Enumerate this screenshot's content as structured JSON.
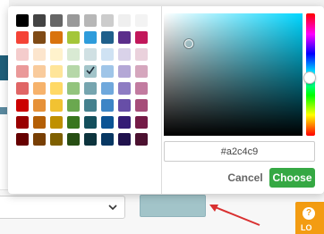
{
  "colors": {
    "accent_green": "#35a843",
    "selected": "#a2c4c9",
    "annotation_red": "#d93030",
    "orange_tab": "#f39c12"
  },
  "palette": {
    "rows": [
      [
        "#000000",
        "#434343",
        "#666666",
        "#999999",
        "#b7b7b7",
        "#cccccc",
        "#efefef",
        "#f3f3f3"
      ],
      [
        "#f44336",
        "#7f4a15",
        "#d9730d",
        "#a4c639",
        "#2e9cdb",
        "#1f5f8b",
        "#5b2e8b",
        "#c2185b"
      ],
      [
        "#f4cccc",
        "#fce5cd",
        "#fff2cc",
        "#d9ead3",
        "#d0e0e3",
        "#cfe2f3",
        "#d9d2e9",
        "#ead1dc"
      ],
      [
        "#ea9999",
        "#f9cb9c",
        "#ffe599",
        "#b6d7a8",
        "#a2c4c9",
        "#9fc5e8",
        "#b4a7d6",
        "#d5a6bd"
      ],
      [
        "#e06666",
        "#f6b26b",
        "#ffd966",
        "#93c47d",
        "#76a5af",
        "#6fa8dc",
        "#8e7cc3",
        "#c27ba0"
      ],
      [
        "#cc0000",
        "#e69138",
        "#f1c232",
        "#6aa84f",
        "#45818e",
        "#3d85c6",
        "#674ea7",
        "#a64d79"
      ],
      [
        "#990000",
        "#b45f06",
        "#bf9000",
        "#38761d",
        "#134f5c",
        "#0b5394",
        "#351c75",
        "#741b47"
      ],
      [
        "#660000",
        "#783f04",
        "#7f6000",
        "#274e13",
        "#0c343d",
        "#073763",
        "#20124d",
        "#4c1130"
      ]
    ],
    "selected_row": 3,
    "selected_col": 4,
    "check_icon": "check-icon"
  },
  "picker": {
    "hue_color": "#00d6ff",
    "hex_value": "#a2c4c9",
    "cancel_label": "Cancel",
    "choose_label": "Choose"
  },
  "background": {
    "select_chevron": "chevron-down-icon",
    "preview_color": "#a2c4c9",
    "tab_label": "LO"
  }
}
